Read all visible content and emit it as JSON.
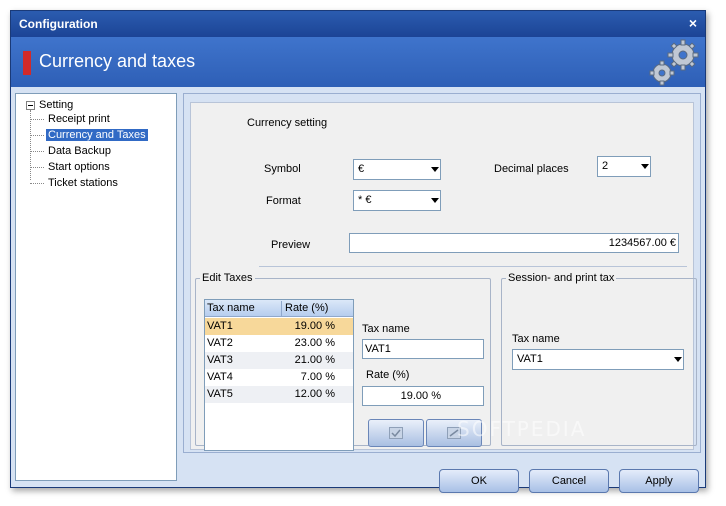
{
  "window": {
    "title": "Configuration",
    "close_glyph": "×"
  },
  "header": {
    "title": "Currency and  taxes",
    "icon": "gears-icon"
  },
  "tree": {
    "root": "Setting",
    "items": [
      "Receipt print",
      "Currency and Taxes",
      "Data Backup",
      "Start options",
      "Ticket stations"
    ],
    "selected_index": 1
  },
  "currency": {
    "section_title": "Currency setting",
    "symbol_label": "Symbol",
    "symbol_value": "€",
    "format_label": "Format",
    "format_value": "* €",
    "decimal_label": "Decimal places",
    "decimal_value": "2",
    "preview_label": "Preview",
    "preview_value": "1234567.00 €"
  },
  "edit_taxes": {
    "title": "Edit Taxes",
    "columns": [
      "Tax name",
      "Rate (%)"
    ],
    "rows": [
      {
        "name": "VAT1",
        "rate": "19.00 %"
      },
      {
        "name": "VAT2",
        "rate": "23.00 %"
      },
      {
        "name": "VAT3",
        "rate": "21.00 %"
      },
      {
        "name": "VAT4",
        "rate": "7.00 %"
      },
      {
        "name": "VAT5",
        "rate": "12.00 %"
      }
    ],
    "tax_name_label": "Tax name",
    "tax_name_value": "VAT1",
    "rate_label": "Rate  (%)",
    "rate_value": "19.00 %"
  },
  "session_tax": {
    "title": "Session- and print tax",
    "tax_name_label": "Tax name",
    "tax_name_value": "VAT1"
  },
  "footer": {
    "ok": "OK",
    "cancel": "Cancel",
    "apply": "Apply"
  },
  "watermark": "SOFTPEDIA",
  "colors": {
    "title_bar": "#1c4496",
    "header_band": "#3f74cc",
    "accent_red": "#d22a2a",
    "selection": "#316ac5",
    "row_highlight": "#f7d89a"
  }
}
